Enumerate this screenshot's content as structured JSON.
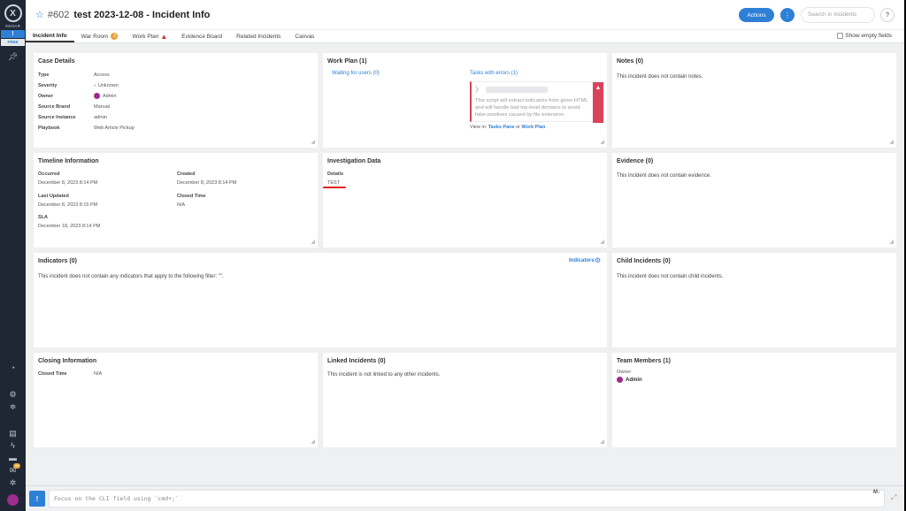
{
  "sidebar": {
    "logo_letter": "X",
    "logo_text": "XSOAR",
    "alert_symbol": "!",
    "free_label": "FREE",
    "badge_count": "99"
  },
  "header": {
    "incident_number": "#602",
    "title": "test 2023-12-08 - Incident Info",
    "actions_label": "Actions",
    "search_placeholder": "Search in Incidents",
    "help_label": "?"
  },
  "tabs": [
    {
      "label": "Incident Info",
      "active": true
    },
    {
      "label": "War Room",
      "badge": "2"
    },
    {
      "label": "Work Plan",
      "warning": true
    },
    {
      "label": "Evidence Board"
    },
    {
      "label": "Related Incidents"
    },
    {
      "label": "Canvas"
    }
  ],
  "show_empty_fields": "Show empty fields",
  "case_details": {
    "title": "Case Details",
    "rows": [
      {
        "label": "Type",
        "value": "Access"
      },
      {
        "label": "Severity",
        "value": "Unknown"
      },
      {
        "label": "Owner",
        "value": "Admin"
      },
      {
        "label": "Source Brand",
        "value": "Manual"
      },
      {
        "label": "Source Instance",
        "value": "admin"
      },
      {
        "label": "Playbook",
        "value": "Web Article Pickup"
      }
    ]
  },
  "work_plan": {
    "title": "Work Plan (1)",
    "waiting_label": "Waiting for users (0)",
    "errors_label": "Tasks with errors (1)",
    "error_description": "This script will extract indicators from given HTML and will handle bad top-level domains to avoid false positives caused by file extension.",
    "view_in": "View in:",
    "tasks_pane": "Tasks Pane",
    "or": "or",
    "work_plan_link": "Work Plan"
  },
  "notes": {
    "title": "Notes (0)",
    "empty": "This incident does not contain notes."
  },
  "timeline": {
    "title": "Timeline Information",
    "occurred_label": "Occurred",
    "occurred_value": "December 8, 2023 8:14 PM",
    "created_label": "Created",
    "created_value": "December 8, 2023 8:14 PM",
    "last_updated_label": "Last Updated",
    "last_updated_value": "December 8, 2023 8:15 PM",
    "closed_time_label": "Closed Time",
    "closed_time_value": "N/A",
    "sla_label": "SLA",
    "sla_value": "December 18, 2023 8:14 PM"
  },
  "investigation": {
    "title": "Investigation Data",
    "details_label": "Details",
    "details_value": "TEST"
  },
  "evidence": {
    "title": "Evidence (0)",
    "empty": "This incident does not contain evidence."
  },
  "indicators": {
    "title": "Indicators (0)",
    "link_label": "Indicators",
    "empty": "This incident does not contain any indicators that apply to the following filter: \"\"."
  },
  "child_incidents": {
    "title": "Child Incidents (0)",
    "empty": "This incident does not contain child incidents."
  },
  "closing": {
    "title": "Closing Information",
    "closed_time_label": "Closed Time",
    "closed_time_value": "N/A"
  },
  "linked": {
    "title": "Linked Incidents (0)",
    "empty": "This incident is not linked to any other incidents."
  },
  "team": {
    "title": "Team Members (1)",
    "owner_label": "Owner",
    "owner_name": "Admin"
  },
  "cli": {
    "button_label": "!",
    "placeholder": "Focus on the CLI field using `cmd+;`",
    "markdown_label": "M↓"
  },
  "colors": {
    "accent": "#2e7fd6",
    "error": "#d9435a",
    "badge": "#e8a33a",
    "avatar": "#9b2d8c"
  }
}
